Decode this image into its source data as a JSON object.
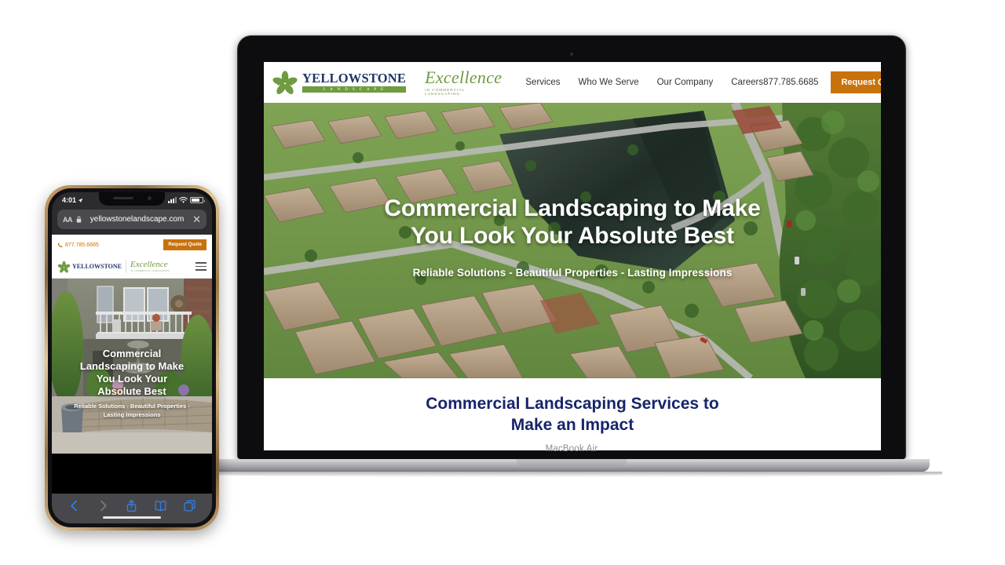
{
  "scene": {
    "laptop_label": "MacBook Air",
    "brand_orange": "#c8720c",
    "brand_green": "#6f9b41",
    "brand_navy": "#1f3566",
    "heading_navy": "#17246b"
  },
  "site": {
    "logo": {
      "name": "YELLOWSTONE",
      "subtitle": "L A N D S C A P E",
      "tagline_script": "Excellence",
      "tagline_sub": "IN COMMERCIAL LANDSCAPING",
      "mark": "five-petal-flower-star"
    },
    "nav": {
      "items": [
        {
          "label": "Services"
        },
        {
          "label": "Who We Serve"
        },
        {
          "label": "Our Company"
        },
        {
          "label": "Careers"
        }
      ],
      "phone": "877.785.6685",
      "cta_label": "Request Quote"
    },
    "hero": {
      "headline_line1": "Commercial Landscaping to Make",
      "headline_line2": "You Look Your Absolute Best",
      "subhead": "Reliable Solutions - Beautiful Properties - Lasting Impressions",
      "image_alt": "aerial-view-residential-community-lake"
    },
    "band": {
      "line1": "Commercial Landscaping Services to",
      "line2": "Make an Impact"
    }
  },
  "phone": {
    "status": {
      "time": "4:01",
      "location_icon": "location-arrow-icon",
      "signal_icon": "cellular-bars-icon",
      "wifi_icon": "wifi-icon",
      "battery_icon": "battery-icon"
    },
    "browser": {
      "aa_label": "AA",
      "lock_icon": "lock-icon",
      "url": "yellowstonelandscape.com",
      "close_label": "✕",
      "toolbar": [
        {
          "name": "back-button",
          "icon": "chevron-left-icon",
          "enabled": true
        },
        {
          "name": "forward-button",
          "icon": "chevron-right-icon",
          "enabled": false
        },
        {
          "name": "share-button",
          "icon": "share-icon",
          "enabled": true
        },
        {
          "name": "bookmarks-button",
          "icon": "book-icon",
          "enabled": true
        },
        {
          "name": "tabs-button",
          "icon": "tabs-icon",
          "enabled": true
        }
      ]
    },
    "site": {
      "phone": "877.785.6685",
      "cta_label": "Request Quote",
      "logo_name": "YELLOWSTONE",
      "tagline_script": "Excellence",
      "tagline_sub": "IN COMMERCIAL LANDSCAPING",
      "menu_icon": "hamburger-menu-icon",
      "hero": {
        "headline_line1": "Commercial",
        "headline_line2": "Landscaping to Make",
        "headline_line3": "You Look Your",
        "headline_line4": "Absolute Best",
        "subhead_line1": "Reliable Solutions - Beautiful Properties -",
        "subhead_line2": "Lasting Impressions",
        "image_alt": "apartment-building-balcony-fountain"
      }
    }
  }
}
